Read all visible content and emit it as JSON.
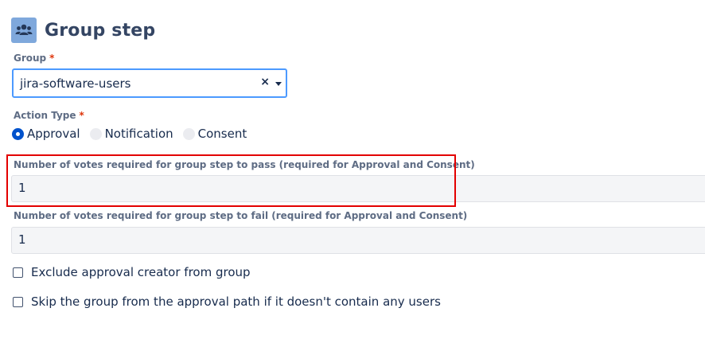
{
  "header": {
    "icon": "group-icon",
    "title": "Group step"
  },
  "group": {
    "label": "Group",
    "required_mark": "*",
    "value": "jira-software-users",
    "clear_glyph": "×"
  },
  "action_type": {
    "label": "Action Type",
    "required_mark": "*",
    "options": [
      {
        "label": "Approval",
        "selected": true
      },
      {
        "label": "Notification",
        "selected": false
      },
      {
        "label": "Consent",
        "selected": false
      }
    ]
  },
  "votes_pass": {
    "label": "Number of votes required for group step to pass (required for Approval and Consent)",
    "value": "1"
  },
  "votes_fail": {
    "label": "Number of votes required for group step to fail (required for Approval and Consent)",
    "value": "1"
  },
  "checkboxes": [
    {
      "label": "Exclude approval creator from group",
      "checked": false
    },
    {
      "label": "Skip the group from the approval path if it doesn't contain any users",
      "checked": false
    }
  ],
  "colors": {
    "accent": "#0052cc",
    "focus_border": "#4c9aff",
    "required": "#de350b",
    "highlight": "#e30000",
    "header_icon_bg": "#7fa8dc"
  }
}
